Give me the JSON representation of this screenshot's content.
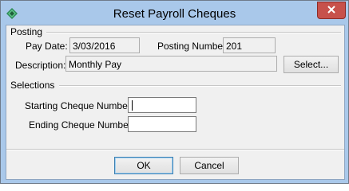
{
  "window": {
    "title": "Reset Payroll Cheques"
  },
  "posting": {
    "section_label": "Posting",
    "pay_date_label": "Pay Date:",
    "pay_date_value": "3/03/2016",
    "posting_number_label": "Posting Number:",
    "posting_number_value": "201",
    "description_label": "Description:",
    "description_value": "Monthly Pay",
    "select_button": "Select..."
  },
  "selections": {
    "section_label": "Selections",
    "starting_label": "Starting Cheque Number:",
    "starting_value": "",
    "ending_label": "Ending Cheque Number:",
    "ending_value": ""
  },
  "buttons": {
    "ok": "OK",
    "cancel": "Cancel"
  },
  "icons": {
    "app": "app-diamond-icon",
    "close": "close-icon"
  },
  "colors": {
    "titlebar": "#a9c8ea",
    "close": "#c7514b",
    "default_border": "#3c7fb1"
  }
}
